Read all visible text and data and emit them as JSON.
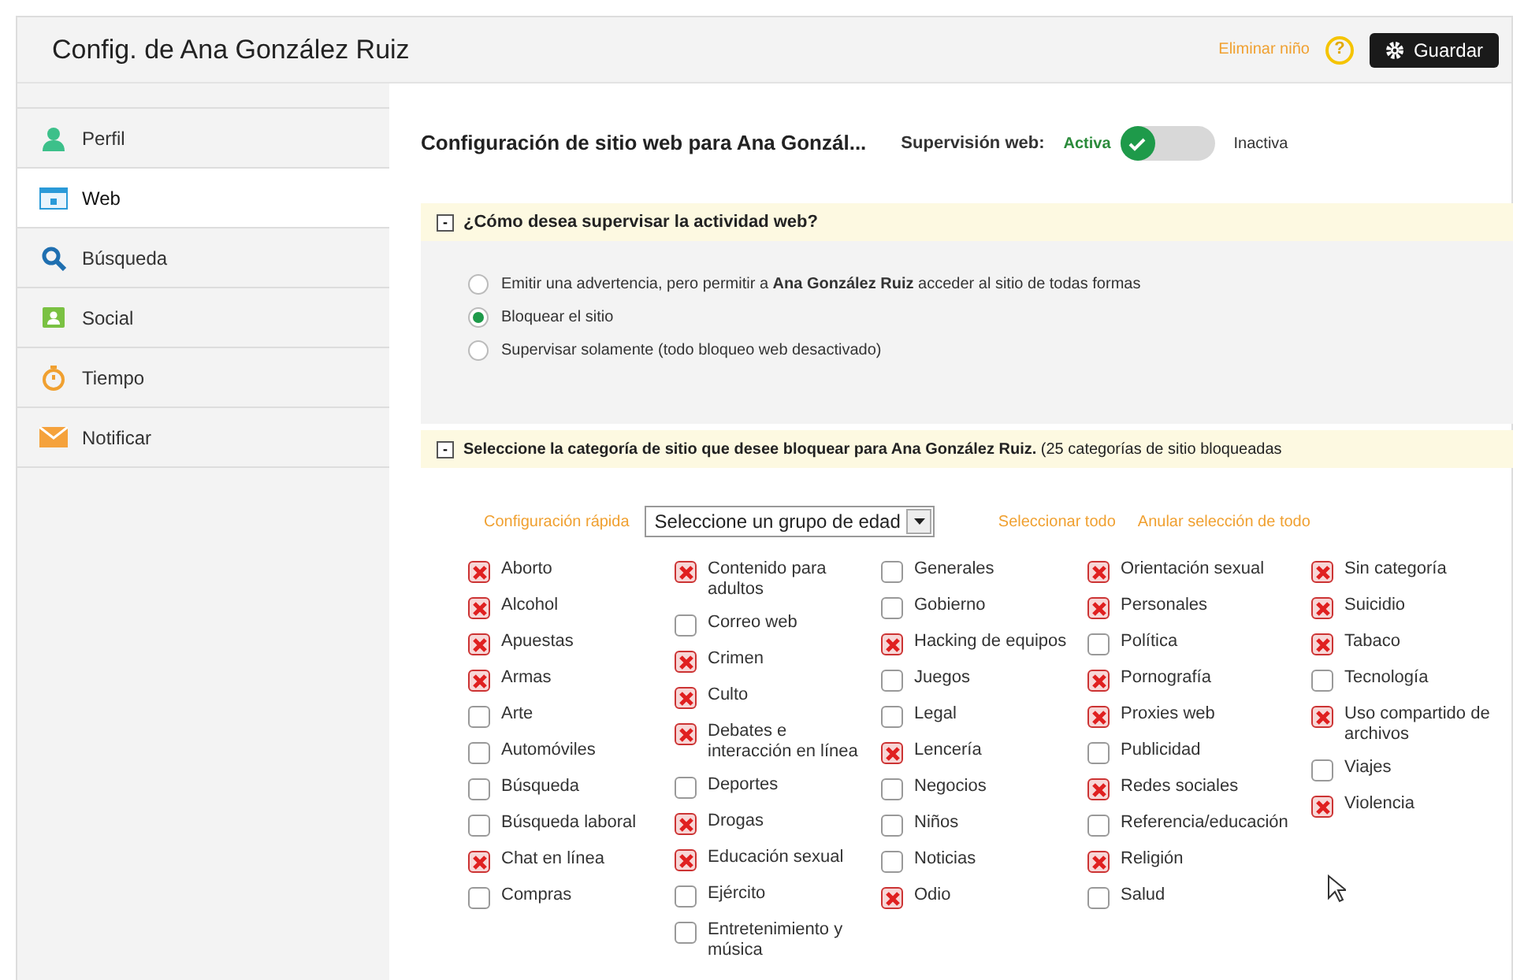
{
  "header": {
    "title": "Config. de Ana González Ruiz",
    "remove_link": "Eliminar niño",
    "help": "?",
    "save_button": "Guardar"
  },
  "sidebar": {
    "items": [
      {
        "label": "Perfil",
        "kind": "profile",
        "selected": false
      },
      {
        "label": "Web",
        "kind": "web",
        "selected": true
      },
      {
        "label": "Búsqueda",
        "kind": "search",
        "selected": false
      },
      {
        "label": "Social",
        "kind": "social",
        "selected": false
      },
      {
        "label": "Tiempo",
        "kind": "time",
        "selected": false
      },
      {
        "label": "Notificar",
        "kind": "notify",
        "selected": false
      }
    ]
  },
  "content": {
    "title": "Configuración de sitio web para Ana Gonzál...",
    "supervision": {
      "label": "Supervisión web:",
      "options": [
        {
          "label": "Activa",
          "selected": true
        },
        {
          "label": "Inactiva",
          "selected": false
        }
      ]
    }
  },
  "section_monitor": {
    "toggle": "-",
    "title": "¿Cómo desea supervisar la actividad web?",
    "options": [
      {
        "label": "Emitir una advertencia, pero permitir a **Ana González Ruiz** acceder al sitio de todas formas",
        "selected": false
      },
      {
        "label": "Bloquear el sitio",
        "selected": true
      },
      {
        "label": "Supervisar solamente (todo bloqueo web desactivado)",
        "selected": false
      }
    ]
  },
  "section_categories": {
    "toggle": "-",
    "title": "**Seleccione la categoría de sitio que desee bloquear para Ana González Ruiz.** (25 categorías de sitio bloqueadas",
    "quick_config": "Configuración rápida",
    "age_select": {
      "value": "Seleccione un grupo de edad"
    },
    "select_all": "Seleccionar todo",
    "deselect_all": "Anular selección de todo",
    "columns": [
      [
        {
          "label": "Aborto",
          "checked": true
        },
        {
          "label": "Alcohol",
          "checked": true
        },
        {
          "label": "Apuestas",
          "checked": true
        },
        {
          "label": "Armas",
          "checked": true
        },
        {
          "label": "Arte",
          "checked": false
        },
        {
          "label": "Automóviles",
          "checked": false
        },
        {
          "label": "Búsqueda",
          "checked": false
        },
        {
          "label": "Búsqueda laboral",
          "checked": false
        },
        {
          "label": "Chat en línea",
          "checked": true
        },
        {
          "label": "Compras",
          "checked": false
        }
      ],
      [
        {
          "label": "Contenido para adultos",
          "checked": true
        },
        {
          "label": "Correo web",
          "checked": false
        },
        {
          "label": "Crimen",
          "checked": true
        },
        {
          "label": "Culto",
          "checked": true
        },
        {
          "label": "Debates e interacción en línea",
          "checked": true
        },
        {
          "label": "Deportes",
          "checked": false
        },
        {
          "label": "Drogas",
          "checked": true
        },
        {
          "label": "Educación sexual",
          "checked": true
        },
        {
          "label": "Ejército",
          "checked": false
        },
        {
          "label": "Entretenimiento y música",
          "checked": false
        }
      ],
      [
        {
          "label": "Generales",
          "checked": false
        },
        {
          "label": "Gobierno",
          "checked": false
        },
        {
          "label": "Hacking de equipos",
          "checked": true
        },
        {
          "label": "Juegos",
          "checked": false
        },
        {
          "label": "Legal",
          "checked": false
        },
        {
          "label": "Lencería",
          "checked": true
        },
        {
          "label": "Negocios",
          "checked": false
        },
        {
          "label": "Niños",
          "checked": false
        },
        {
          "label": "Noticias",
          "checked": false
        },
        {
          "label": "Odio",
          "checked": true
        }
      ],
      [
        {
          "label": "Orientación sexual",
          "checked": true
        },
        {
          "label": "Personales",
          "checked": true
        },
        {
          "label": "Política",
          "checked": false
        },
        {
          "label": "Pornografía",
          "checked": true
        },
        {
          "label": "Proxies web",
          "checked": true
        },
        {
          "label": "Publicidad",
          "checked": false
        },
        {
          "label": "Redes sociales",
          "checked": true
        },
        {
          "label": "Referencia/educación",
          "checked": false
        },
        {
          "label": "Religión",
          "checked": true
        },
        {
          "label": "Salud",
          "checked": false
        }
      ],
      [
        {
          "label": "Sin categoría",
          "checked": true
        },
        {
          "label": "Suicidio",
          "checked": true
        },
        {
          "label": "Tabaco",
          "checked": true
        },
        {
          "label": "Tecnología",
          "checked": false
        },
        {
          "label": "Uso compartido de archivos",
          "checked": true
        },
        {
          "label": "Viajes",
          "checked": false
        },
        {
          "label": "Violencia",
          "checked": true
        }
      ]
    ]
  }
}
